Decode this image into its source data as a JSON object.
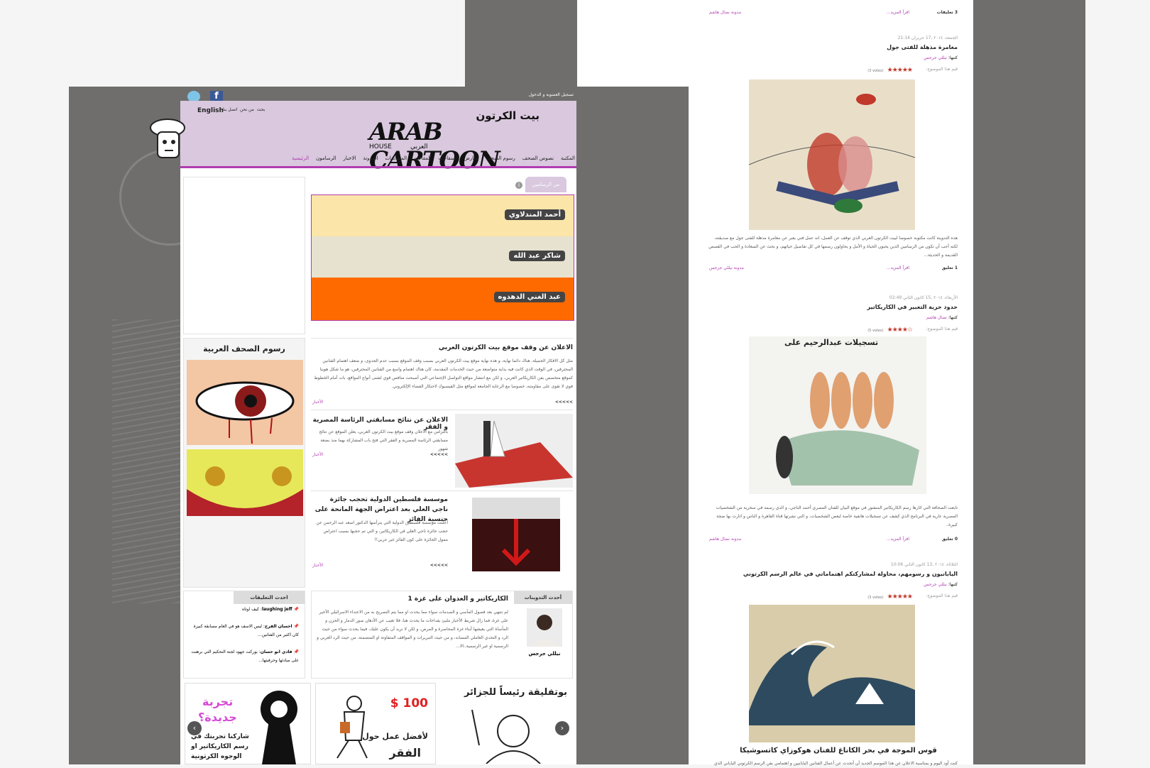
{
  "header": {
    "topbar_link": "تسجيل العضوية و الدخول",
    "lang_link": "English",
    "util_links": [
      "بحث",
      "من نحن",
      "اتصل بنا"
    ],
    "logo_en": "ARAB CARTOON",
    "logo_house": "HOUSE",
    "logo_ar_top": "بيت الكرتون",
    "logo_ar_bottom": "العربي",
    "nav": [
      "الرئيسية",
      "الرسامون",
      "الاخبار",
      "المدونة",
      "المسابقات",
      "المقالات",
      "لسقاءات",
      "معارض",
      "رسوم الصحف",
      "نصوص الصحف",
      "المكتبة"
    ]
  },
  "artists": {
    "tab_label": "من الرسامين",
    "names": [
      "أحمد المندلاوي",
      "شاكر عبد الله",
      "عبد الغني الدهدوه"
    ]
  },
  "press_cartoons": {
    "title": "رسوم الصحف العربية"
  },
  "news": [
    {
      "title": "الاعلان عن وقف موقع بيت الكرتون العربي",
      "body": "مثل كل الافكار الجميلة، هناك دائما نهاية، و هذه نهاية موقع بيت الكرتون العربي بسبب وقف الموقع بسبب عدم الجدوى، و ضعف اهتمام الفنانين المحترفين، في الوقت الذي كانت فيه بداية متواضعة من حيث الخدمات المقدمة، كان هناك اهتمام واسع من الفنانين المحترفين، هو ما شكل هوينا كموقع متخصص بفن الكاريكاتير العربي، و لكن مع انتشار مواقع التواصل الإجتماعي التي أصبحت منافس قوي لشتى أنواع المواقع، بات أمام الخطوط قوي لا تقوى على مقاومته، خصوصا مع الرعاية الجامعة لمواقع مثل الفيسبوك لاحتكار الفضاء الإلكتروني.",
      "category": "الأخبار",
      "more": "<<<<<"
    },
    {
      "title": "الاعلان عن نتائج مسابقتي الرئاسة المصرية و الفقر",
      "body": "بالتزامن مع الاعلان وقف موقع بيت الكرتون العربي، يعلن الموقع عن نتائج مسابقتي الرئاسة المصرية و الفقر التي فتح باب المشاركة بهما منذ بضعة شهور",
      "category": "الأخبار",
      "more": "<<<<<"
    },
    {
      "title": "موسسة فلسطين الدولية تحجب جائزة ناجي العلي بعد اعتراض الجهة المانحة على جنسية الفائز",
      "body": "أعلنت موسسة فلسطين الدولية التي يترأسها الدكتور اسعد عبد الرحمن عن حجب جائزة ناجي العلي في الكاريكاتير، و التي تم حجبها بسبب اعتراض ممول الجائزة على كون الفائز غير عربي!!",
      "category": "الأخبار",
      "more": "<<<<<"
    }
  ],
  "blog_tab": "أحدث التدوينات",
  "blog_post": {
    "title": "الكاريكاتير و العدوان على غزة 1",
    "body": "لم تنتهي بعد فصول المآسي و الصدمات سواء مما يحدث او مما يتم التصريح به من الاعتداء الاسرائيلي الأخير على غزة، فما زال شريط الأخبار مليئ بفداحات ما يحدث هنا، فلا تغيب عن الأذهان صور الدمار و الحزن و المأساة التي يعيشها أبناء غزة المحاصرة و المرض، و لكن لا نريد أن يكون عليك، فيما يحدث سواء من حيث الرد و التحدي العاملي المساند، و من حيث التبريرات و المواقف المتفاوتة او المتضمنة، من حيث الرد العربي و الرسمية او غير الرسمية..الا...",
    "author": "نيللي جرجس"
  },
  "comments_tab": "احدث التعليقات",
  "comments": [
    {
      "author": "laughing jeff",
      "text": "كيف اوثاه"
    },
    {
      "author": "احسان الفرح",
      "text": "ليس الاسف هو في العام مسابقة كبيرة كان اكثير من الفنانين..."
    },
    {
      "author": "فادي ابو حسان",
      "text": "بوركت جهود لجنة التحكيم التي برهنت على مبادئها وحرفيتها..."
    }
  ],
  "banners": [
    {
      "title": "بوتفليقة رئيساً للجزائر"
    },
    {
      "price": "$ 100",
      "line1": "لأفضل عمل حول",
      "line2": "الفقر"
    },
    {
      "line1": "تجربة",
      "line2": "جديدة؟",
      "line3": "شاركنا تجربتك في",
      "line4": "رسم الكاريكاتير او",
      "line5": "الوجوه الكرتونية"
    }
  ],
  "back_posts": [
    {
      "comments_label": "3 تعليقات",
      "read_more": "اقرأ المزيد...",
      "blog_link": "مدونة نضال هاشم"
    },
    {
      "date": "الجمعة، ٢٠١٤ ,17 حزيران 21:14",
      "title": "مغامرة مذهلة للفتى جول",
      "author_label": "كتبها:",
      "author": "نيللي جرجس",
      "rate_label": "قيم هذا الموضوع:",
      "stars": "★★★★★",
      "votes": "(3 votes)",
      "caption": "",
      "body": "هذه التدوينة كانت مكتوبة خصوصا لبيت الكرتون العربي الذي توقف عن العمل، انه عمل فني يعبر عن مغامرة مذهلة للفتى جول مع صديقته، لكنه أحب أن تكون من الرسامين الذين يحبون الحياة و الأمل و يحاولون رسمها في كل تفاصيل حياتهم، و بحث عن السعادة و الحب في القصص القديمة و الحديثة...",
      "comments_label": "1 تعليق",
      "read_more": "اقرأ المزيد...",
      "blog_link": "مدونة نيللي جرجس"
    },
    {
      "date": "الأربعاء، ٢٠١٤ ,15 كانون الثاني 02:49",
      "title": "حدود حرية التعبير في الكاريكاتير",
      "author_label": "كتبها:",
      "author": "نضال هاشم",
      "rate_label": "قيم هذا الموضوع:",
      "stars": "★★★★☆",
      "votes": "(5 votes)",
      "caption": "تسجيلات عبدالرحيم على",
      "body": "تابعت الصحافة التي اثارها رسم الكاريكاتير المنشور في موقع البيان للفنان المصري أحمد الناجي، و الذي رسمه في سخرية من الشخصيات المصرية عارية في البرنامج الذي كشف عن تسجيلات هاتفية خاصة لبعض الشخصيات، و التي نشرتها قناة القاهرة و الناس و اثارت بها ضجة كبيرة..",
      "comments_label": "0 تعليق",
      "read_more": "اقرأ المزيد...",
      "blog_link": "مدونة نضال هاشم"
    },
    {
      "date": "الثلاثاء، ٢٠١٤ ,13 كانون الثاني 10:06",
      "title": "اليابانيون و رسومهم، محاولة لمشاركتكم اهتماماتي في عالم الرسم الكرتوني",
      "author_label": "كتبها:",
      "author": "نيللي جرجس",
      "rate_label": "قيم هذا الموضوع:",
      "stars": "★★★★★",
      "votes": "(3 votes)",
      "caption": "قوس الموجة في بحر الكاناغ للفنان هوكوزاي كاتسوشيكا",
      "body": "كنت أود اليوم و بمناسبة الاعلان عن هذا الموسم الجديد أن أتحدث عن أعمال الفنانين اليابانيين و اهتمامي بفن الرسم الكرتوني الياباني الذي انتشر عالميا..."
    }
  ],
  "colors": {
    "accent": "#b13db1",
    "header_bg": "#d9c8de",
    "backdrop": "#6f6e6c",
    "orange": "#ff6a00"
  }
}
